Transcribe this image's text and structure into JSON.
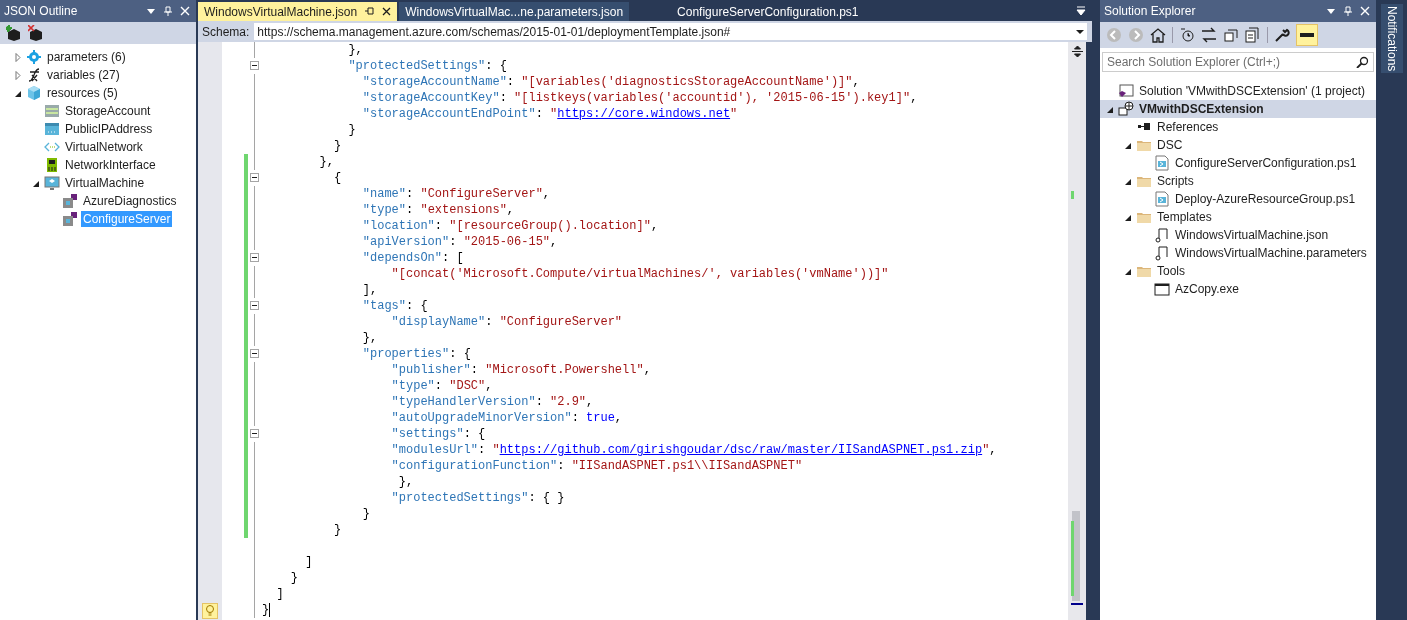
{
  "json_outline": {
    "title": "JSON Outline",
    "items": [
      {
        "label": "parameters (6)",
        "kind": "gear",
        "expanded": false,
        "selected": false
      },
      {
        "label": "variables (27)",
        "kind": "variable",
        "expanded": false,
        "selected": false
      },
      {
        "label": "resources (5)",
        "kind": "cube",
        "expanded": true,
        "selected": false,
        "children": [
          {
            "label": "StorageAccount",
            "kind": "storage",
            "selected": false
          },
          {
            "label": "PublicIPAddress",
            "kind": "ip",
            "selected": false
          },
          {
            "label": "VirtualNetwork",
            "kind": "network",
            "selected": false
          },
          {
            "label": "NetworkInterface",
            "kind": "nic",
            "selected": false
          },
          {
            "label": "VirtualMachine",
            "kind": "vm",
            "expanded": true,
            "selected": false,
            "children": [
              {
                "label": "AzureDiagnostics",
                "kind": "extension",
                "selected": false
              },
              {
                "label": "ConfigureServer",
                "kind": "extension",
                "selected": true
              }
            ]
          }
        ]
      }
    ]
  },
  "editor": {
    "tabs": [
      {
        "label": "WindowsVirtualMachine.json",
        "selected": true
      },
      {
        "label": "WindowsVirtualMac...ne.parameters.json",
        "selected": false
      },
      {
        "label": "ConfigureServerConfiguration.ps1",
        "selected": false
      }
    ],
    "schema_label": "Schema:",
    "schema_value": "https://schema.management.azure.com/schemas/2015-01-01/deploymentTemplate.json#",
    "lines": [
      {
        "changed": false,
        "fold": false,
        "tokens": [
          {
            "kind": "punct",
            "text": "            },"
          }
        ]
      },
      {
        "changed": false,
        "fold": true,
        "tokens": [
          {
            "kind": "key",
            "text": "            \"protectedSettings\""
          },
          {
            "kind": "punct",
            "text": ": {"
          }
        ]
      },
      {
        "changed": false,
        "fold": false,
        "tokens": [
          {
            "kind": "key",
            "text": "              \"storageAccountName\""
          },
          {
            "kind": "punct",
            "text": ": "
          },
          {
            "kind": "string",
            "text": "\"[variables('diagnosticsStorageAccountName')]\""
          },
          {
            "kind": "punct",
            "text": ","
          }
        ]
      },
      {
        "changed": false,
        "fold": false,
        "tokens": [
          {
            "kind": "key",
            "text": "              \"storageAccountKey\""
          },
          {
            "kind": "punct",
            "text": ": "
          },
          {
            "kind": "string",
            "text": "\"[listkeys(variables('accountid'), '2015-06-15').key1]\""
          },
          {
            "kind": "punct",
            "text": ","
          }
        ]
      },
      {
        "changed": false,
        "fold": false,
        "tokens": [
          {
            "kind": "key",
            "text": "              \"storageAccountEndPoint\""
          },
          {
            "kind": "punct",
            "text": ": "
          },
          {
            "kind": "string",
            "text": "\""
          },
          {
            "kind": "link",
            "text": "https://core.windows.net"
          },
          {
            "kind": "string",
            "text": "\""
          }
        ]
      },
      {
        "changed": false,
        "fold": false,
        "tokens": [
          {
            "kind": "punct",
            "text": "            }"
          }
        ]
      },
      {
        "changed": false,
        "fold": false,
        "tokens": [
          {
            "kind": "punct",
            "text": "          }"
          }
        ]
      },
      {
        "changed": true,
        "fold": false,
        "tokens": [
          {
            "kind": "punct",
            "text": "        },"
          }
        ]
      },
      {
        "changed": true,
        "fold": true,
        "tokens": [
          {
            "kind": "punct",
            "text": "          {"
          }
        ]
      },
      {
        "changed": true,
        "fold": false,
        "tokens": [
          {
            "kind": "key",
            "text": "              \"name\""
          },
          {
            "kind": "punct",
            "text": ": "
          },
          {
            "kind": "string",
            "text": "\"ConfigureServer\""
          },
          {
            "kind": "punct",
            "text": ","
          }
        ]
      },
      {
        "changed": true,
        "fold": false,
        "tokens": [
          {
            "kind": "key",
            "text": "              \"type\""
          },
          {
            "kind": "punct",
            "text": ": "
          },
          {
            "kind": "string",
            "text": "\"extensions\""
          },
          {
            "kind": "punct",
            "text": ","
          }
        ]
      },
      {
        "changed": true,
        "fold": false,
        "tokens": [
          {
            "kind": "key",
            "text": "              \"location\""
          },
          {
            "kind": "punct",
            "text": ": "
          },
          {
            "kind": "string",
            "text": "\"[resourceGroup().location]\""
          },
          {
            "kind": "punct",
            "text": ","
          }
        ]
      },
      {
        "changed": true,
        "fold": false,
        "tokens": [
          {
            "kind": "key",
            "text": "              \"apiVersion\""
          },
          {
            "kind": "punct",
            "text": ": "
          },
          {
            "kind": "string",
            "text": "\"2015-06-15\""
          },
          {
            "kind": "punct",
            "text": ","
          }
        ]
      },
      {
        "changed": true,
        "fold": true,
        "tokens": [
          {
            "kind": "key",
            "text": "              \"dependsOn\""
          },
          {
            "kind": "punct",
            "text": ": ["
          }
        ]
      },
      {
        "changed": true,
        "fold": false,
        "tokens": [
          {
            "kind": "string",
            "text": "                  \"[concat('Microsoft.Compute/virtualMachines/', variables('vmName'))]\""
          }
        ]
      },
      {
        "changed": true,
        "fold": false,
        "tokens": [
          {
            "kind": "punct",
            "text": "              ],"
          }
        ]
      },
      {
        "changed": true,
        "fold": true,
        "tokens": [
          {
            "kind": "key",
            "text": "              \"tags\""
          },
          {
            "kind": "punct",
            "text": ": {"
          }
        ]
      },
      {
        "changed": true,
        "fold": false,
        "tokens": [
          {
            "kind": "key",
            "text": "                  \"displayName\""
          },
          {
            "kind": "punct",
            "text": ": "
          },
          {
            "kind": "string",
            "text": "\"ConfigureServer\""
          }
        ]
      },
      {
        "changed": true,
        "fold": false,
        "tokens": [
          {
            "kind": "punct",
            "text": "              },"
          }
        ]
      },
      {
        "changed": true,
        "fold": true,
        "tokens": [
          {
            "kind": "key",
            "text": "              \"properties\""
          },
          {
            "kind": "punct",
            "text": ": {"
          }
        ]
      },
      {
        "changed": true,
        "fold": false,
        "tokens": [
          {
            "kind": "key",
            "text": "                  \"publisher\""
          },
          {
            "kind": "punct",
            "text": ": "
          },
          {
            "kind": "string",
            "text": "\"Microsoft.Powershell\""
          },
          {
            "kind": "punct",
            "text": ","
          }
        ]
      },
      {
        "changed": true,
        "fold": false,
        "tokens": [
          {
            "kind": "key",
            "text": "                  \"type\""
          },
          {
            "kind": "punct",
            "text": ": "
          },
          {
            "kind": "string",
            "text": "\"DSC\""
          },
          {
            "kind": "punct",
            "text": ","
          }
        ]
      },
      {
        "changed": true,
        "fold": false,
        "tokens": [
          {
            "kind": "key",
            "text": "                  \"typeHandlerVersion\""
          },
          {
            "kind": "punct",
            "text": ": "
          },
          {
            "kind": "string",
            "text": "\"2.9\""
          },
          {
            "kind": "punct",
            "text": ","
          }
        ]
      },
      {
        "changed": true,
        "fold": false,
        "tokens": [
          {
            "kind": "key",
            "text": "                  \"autoUpgradeMinorVersion\""
          },
          {
            "kind": "punct",
            "text": ": "
          },
          {
            "kind": "keyword",
            "text": "true"
          },
          {
            "kind": "punct",
            "text": ","
          }
        ]
      },
      {
        "changed": true,
        "fold": true,
        "tokens": [
          {
            "kind": "key",
            "text": "                  \"settings\""
          },
          {
            "kind": "punct",
            "text": ": {"
          }
        ]
      },
      {
        "changed": true,
        "fold": false,
        "tokens": [
          {
            "kind": "key",
            "text": "                  \"modulesUrl\""
          },
          {
            "kind": "punct",
            "text": ": "
          },
          {
            "kind": "string",
            "text": "\""
          },
          {
            "kind": "link",
            "text": "https://github.com/girishgoudar/dsc/raw/master/IISandASPNET.ps1.zip"
          },
          {
            "kind": "string",
            "text": "\""
          },
          {
            "kind": "punct",
            "text": ","
          }
        ]
      },
      {
        "changed": true,
        "fold": false,
        "tokens": [
          {
            "kind": "key",
            "text": "                  \"configurationFunction\""
          },
          {
            "kind": "punct",
            "text": ": "
          },
          {
            "kind": "string",
            "text": "\"IISandASPNET.ps1\\\\IISandASPNET\""
          }
        ]
      },
      {
        "changed": true,
        "fold": false,
        "tokens": [
          {
            "kind": "punct",
            "text": "                   },"
          }
        ]
      },
      {
        "changed": true,
        "fold": false,
        "tokens": [
          {
            "kind": "key",
            "text": "                  \"protectedSettings\""
          },
          {
            "kind": "punct",
            "text": ": { }"
          }
        ]
      },
      {
        "changed": true,
        "fold": false,
        "tokens": [
          {
            "kind": "punct",
            "text": "              }"
          }
        ]
      },
      {
        "changed": true,
        "fold": false,
        "tokens": [
          {
            "kind": "punct",
            "text": "          }"
          }
        ]
      },
      {
        "changed": false,
        "fold": false
      },
      {
        "changed": false,
        "fold": false,
        "tokens": [
          {
            "kind": "punct",
            "text": "      ]"
          }
        ]
      },
      {
        "changed": false,
        "fold": false,
        "tokens": [
          {
            "kind": "punct",
            "text": "    }"
          }
        ]
      },
      {
        "changed": false,
        "fold": false,
        "tokens": [
          {
            "kind": "punct",
            "text": "  ]"
          }
        ]
      },
      {
        "changed": false,
        "fold": false,
        "tokens": [
          {
            "kind": "punct",
            "text": "}"
          }
        ]
      }
    ]
  },
  "solution_explorer": {
    "title": "Solution Explorer",
    "search_placeholder": "Search Solution Explorer (Ctrl+;)",
    "items": [
      {
        "label": "Solution 'VMwithDSCExtension' (1 project)",
        "kind": "solution",
        "selected": false
      },
      {
        "label": "VMwithDSCExtension",
        "kind": "project",
        "expanded": true,
        "selected": true,
        "children": [
          {
            "label": "References",
            "kind": "references",
            "selected": false
          },
          {
            "label": "DSC",
            "kind": "folder",
            "expanded": true,
            "selected": false,
            "children": [
              {
                "label": "ConfigureServerConfiguration.ps1",
                "kind": "script",
                "selected": false
              }
            ]
          },
          {
            "label": "Scripts",
            "kind": "folder",
            "expanded": true,
            "selected": false,
            "children": [
              {
                "label": "Deploy-AzureResourceGroup.ps1",
                "kind": "script",
                "selected": false
              }
            ]
          },
          {
            "label": "Templates",
            "kind": "folder",
            "expanded": true,
            "selected": false,
            "children": [
              {
                "label": "WindowsVirtualMachine.json",
                "kind": "template",
                "selected": false
              },
              {
                "label": "WindowsVirtualMachine.parameters",
                "kind": "template",
                "selected": false
              }
            ]
          },
          {
            "label": "Tools",
            "kind": "folder",
            "expanded": true,
            "selected": false,
            "children": [
              {
                "label": "AzCopy.exe",
                "kind": "exe",
                "selected": false
              }
            ]
          }
        ]
      }
    ]
  },
  "notifications": {
    "label": "Notifications"
  }
}
